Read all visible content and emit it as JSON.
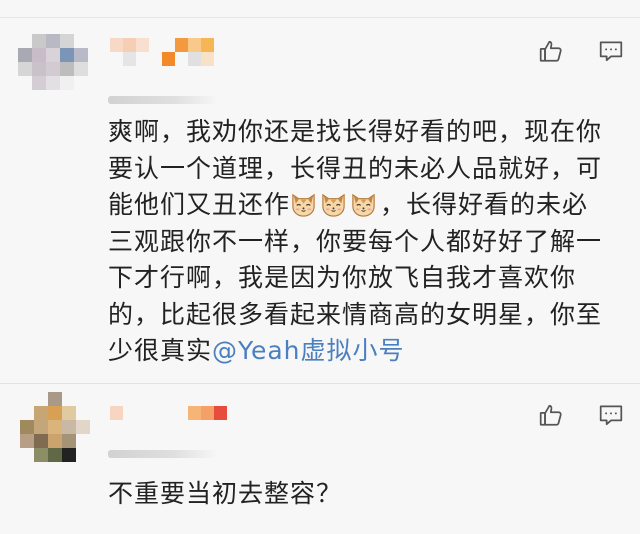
{
  "comments": [
    {
      "text_lines": [
        "爽啊，我劝你还是找长得好看的吧，现在你",
        "要认一个道理，长得丑的未必人品就好，可",
        "能他们又丑还作",
        "，长得好看的未必",
        "三观跟你不一样，你要每个人都好好了解一",
        "下才行啊，我是因为你放飞自我才喜欢你",
        "的，比起很多看起来情商高的女明星，你至",
        "少很真实"
      ],
      "mention": "@Yeah虚拟小号",
      "emoji_name": "cat-face-emoji",
      "emoji_count": 3,
      "like_icon": "thumbs-up-icon",
      "reply_icon": "comment-icon"
    },
    {
      "text": "不重要当初去整容？",
      "like_icon": "thumbs-up-icon",
      "reply_icon": "comment-icon"
    }
  ],
  "colors": {
    "background": "#f7f7f7",
    "text": "#222222",
    "mention": "#4a7fc0",
    "icon": "#555555"
  }
}
